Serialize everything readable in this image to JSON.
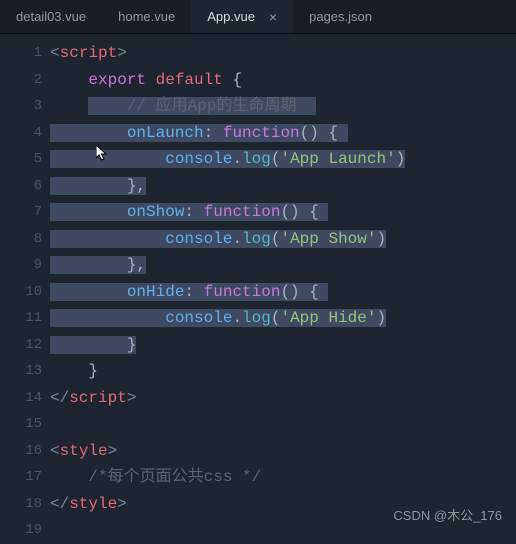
{
  "tabs": [
    {
      "label": "detail03.vue",
      "active": false
    },
    {
      "label": "home.vue",
      "active": false
    },
    {
      "label": "App.vue",
      "active": true
    },
    {
      "label": "pages.json",
      "active": false
    }
  ],
  "close_glyph": "×",
  "lines": {
    "n1": "1",
    "n2": "2",
    "n3": "3",
    "n4": "4",
    "n5": "5",
    "n6": "6",
    "n7": "7",
    "n8": "8",
    "n9": "9",
    "n10": "10",
    "n11": "11",
    "n12": "12",
    "n13": "13",
    "n14": "14",
    "n15": "15",
    "n16": "16",
    "n17": "17",
    "n18": "18",
    "n19": "19"
  },
  "code": {
    "l1": {
      "open": "<",
      "tag": "script",
      "close": ">"
    },
    "l2": {
      "kw1": "export",
      "kw2": "default",
      "brace": "{"
    },
    "l3": {
      "comment": "// 应用App的生命周期"
    },
    "l4": {
      "prop": "onLaunch",
      "colon": ":",
      "fn": "function",
      "parens": "()",
      "brace": "{"
    },
    "l5": {
      "console": "console",
      "dot": ".",
      "method": "log",
      "open": "(",
      "str": "'App Launch'",
      "close": ")"
    },
    "l6": {
      "close": "},"
    },
    "l7": {
      "prop": "onShow",
      "colon": ":",
      "fn": "function",
      "parens": "()",
      "brace": "{"
    },
    "l8": {
      "console": "console",
      "dot": ".",
      "method": "log",
      "open": "(",
      "str": "'App Show'",
      "close": ")"
    },
    "l9": {
      "close": "},"
    },
    "l10": {
      "prop": "onHide",
      "colon": ":",
      "fn": "function",
      "parens": "()",
      "brace": "{"
    },
    "l11": {
      "console": "console",
      "dot": ".",
      "method": "log",
      "open": "(",
      "str": "'App Hide'",
      "close": ")"
    },
    "l12": {
      "close": "}"
    },
    "l13": {
      "close": "}"
    },
    "l14": {
      "open": "</",
      "tag": "script",
      "close": ">"
    },
    "l16": {
      "open": "<",
      "tag": "style",
      "close": ">"
    },
    "l17": {
      "comment": "/*每个页面公共css */"
    },
    "l18": {
      "open": "</",
      "tag": "style",
      "close": ">"
    }
  },
  "watermark": "CSDN @木公_176"
}
